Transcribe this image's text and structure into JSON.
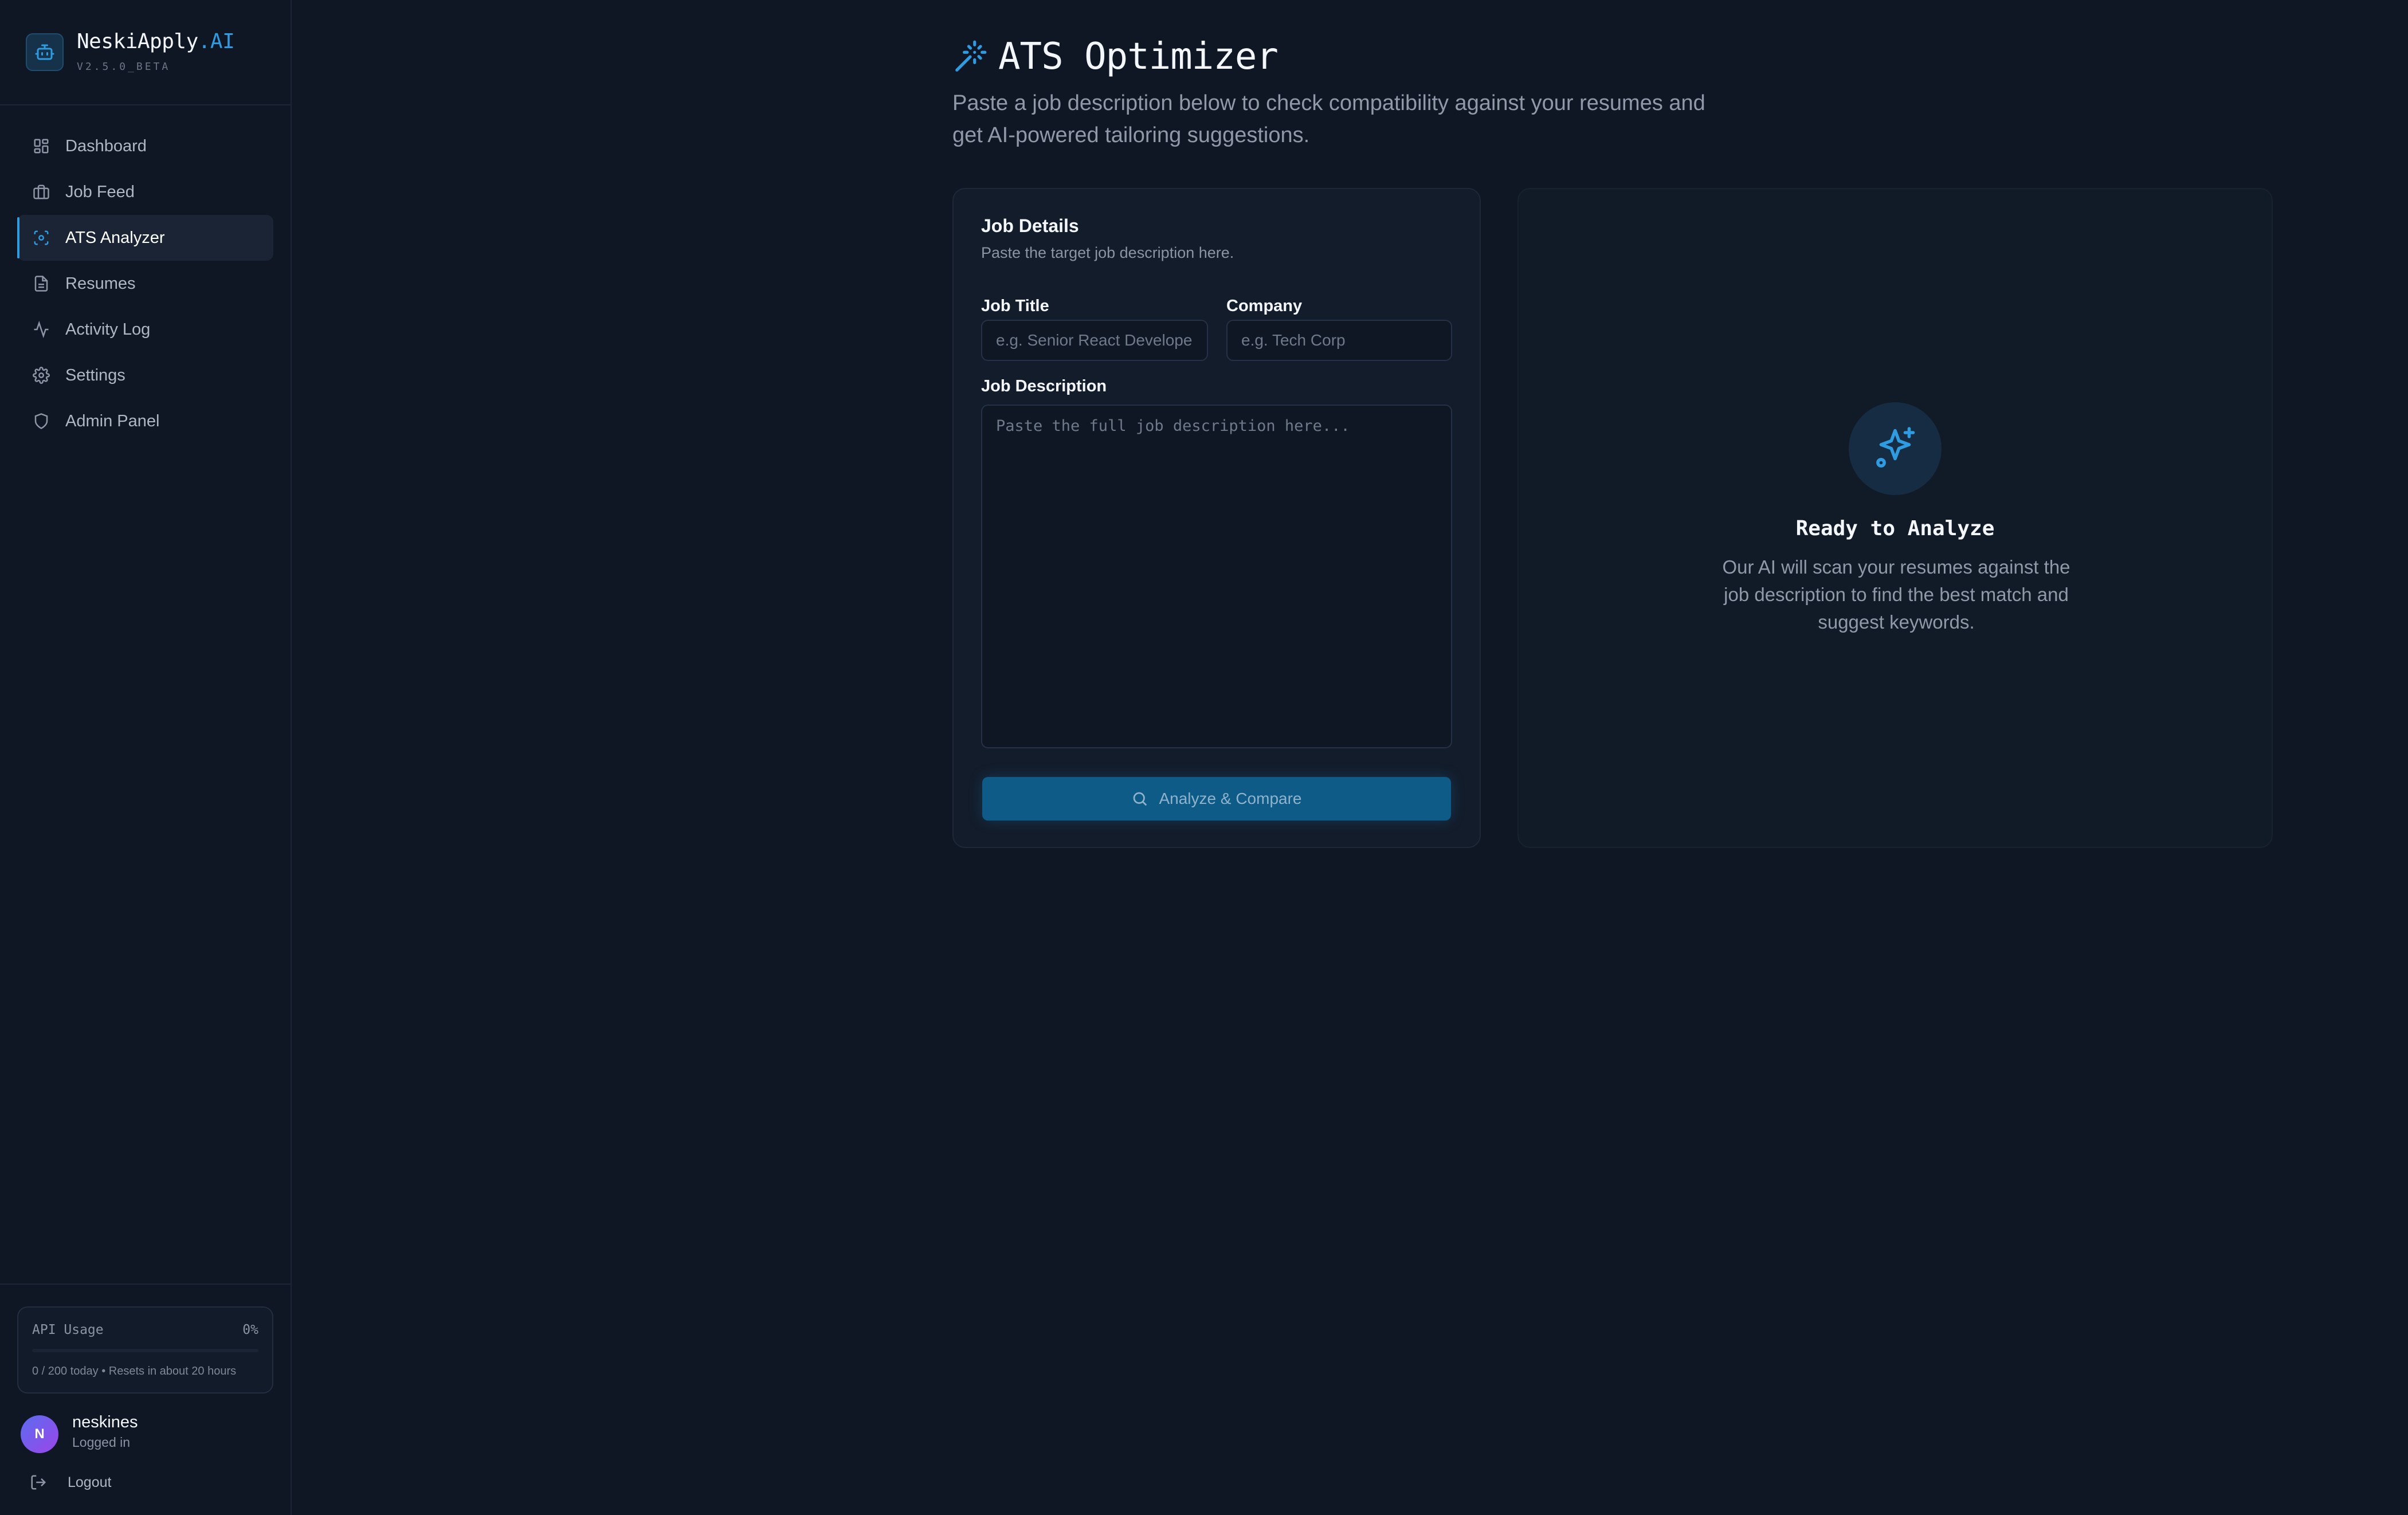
{
  "brand": {
    "name": "NeskiApply",
    "name_accent": ".AI",
    "version": "V2.5.0_BETA",
    "icon": "robot-icon"
  },
  "sidebar": {
    "items": [
      {
        "label": "Dashboard",
        "icon": "grid-icon",
        "active": false
      },
      {
        "label": "Job Feed",
        "icon": "briefcase-icon",
        "active": false
      },
      {
        "label": "ATS Analyzer",
        "icon": "scan-icon",
        "active": true
      },
      {
        "label": "Resumes",
        "icon": "document-icon",
        "active": false
      },
      {
        "label": "Activity Log",
        "icon": "activity-icon",
        "active": false
      },
      {
        "label": "Settings",
        "icon": "gear-icon",
        "active": false
      },
      {
        "label": "Admin Panel",
        "icon": "shield-icon",
        "active": false
      }
    ]
  },
  "usage": {
    "label": "API Usage",
    "percent_label": "0%",
    "percent": 0,
    "note": "0 / 200 today • Resets in about 20 hours"
  },
  "user": {
    "initial": "N",
    "name": "neskines",
    "status": "Logged in"
  },
  "logout_label": "Logout",
  "page": {
    "title": "ATS Optimizer",
    "subtitle": "Paste a job description below to check compatibility against your resumes and get AI-powered tailoring suggestions."
  },
  "job_card": {
    "title": "Job Details",
    "description": "Paste the target job description here.",
    "job_title_label": "Job Title",
    "job_title_placeholder": "e.g. Senior React Developer",
    "company_label": "Company",
    "company_placeholder": "e.g. Tech Corp",
    "job_description_label": "Job Description",
    "job_description_placeholder": "Paste the full job description here...",
    "analyze_label": "Analyze & Compare"
  },
  "result_card": {
    "title": "Ready to Analyze",
    "text": "Our AI will scan your resumes against the job description to find the best match and suggest keywords."
  },
  "colors": {
    "accent": "#2f9be0",
    "background": "#0f1624",
    "card": "#131c2a",
    "button": "#0d5b86"
  }
}
